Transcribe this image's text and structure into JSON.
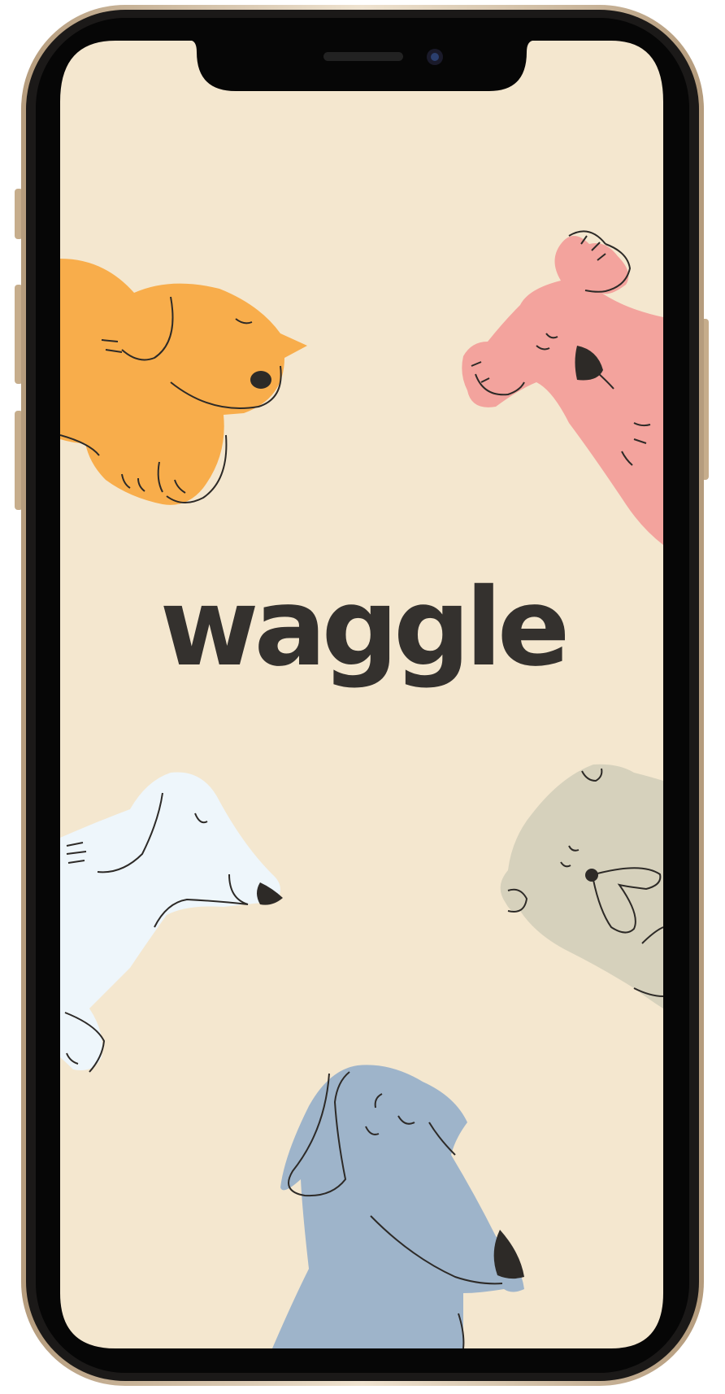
{
  "app": {
    "brand_name": "waggle"
  },
  "colors": {
    "background": "#f4e7cf",
    "wordmark": "#34312e",
    "dog_orange": "#f8ad4b",
    "dog_pink": "#f3a39d",
    "dog_white": "#eef6fb",
    "dog_gray": "#d6d1bc",
    "dog_blue": "#9eb4ca",
    "line": "#2d2a27"
  },
  "illustrations": [
    "orange-dog",
    "pink-dog",
    "white-dog",
    "gray-dog",
    "blue-dog"
  ]
}
